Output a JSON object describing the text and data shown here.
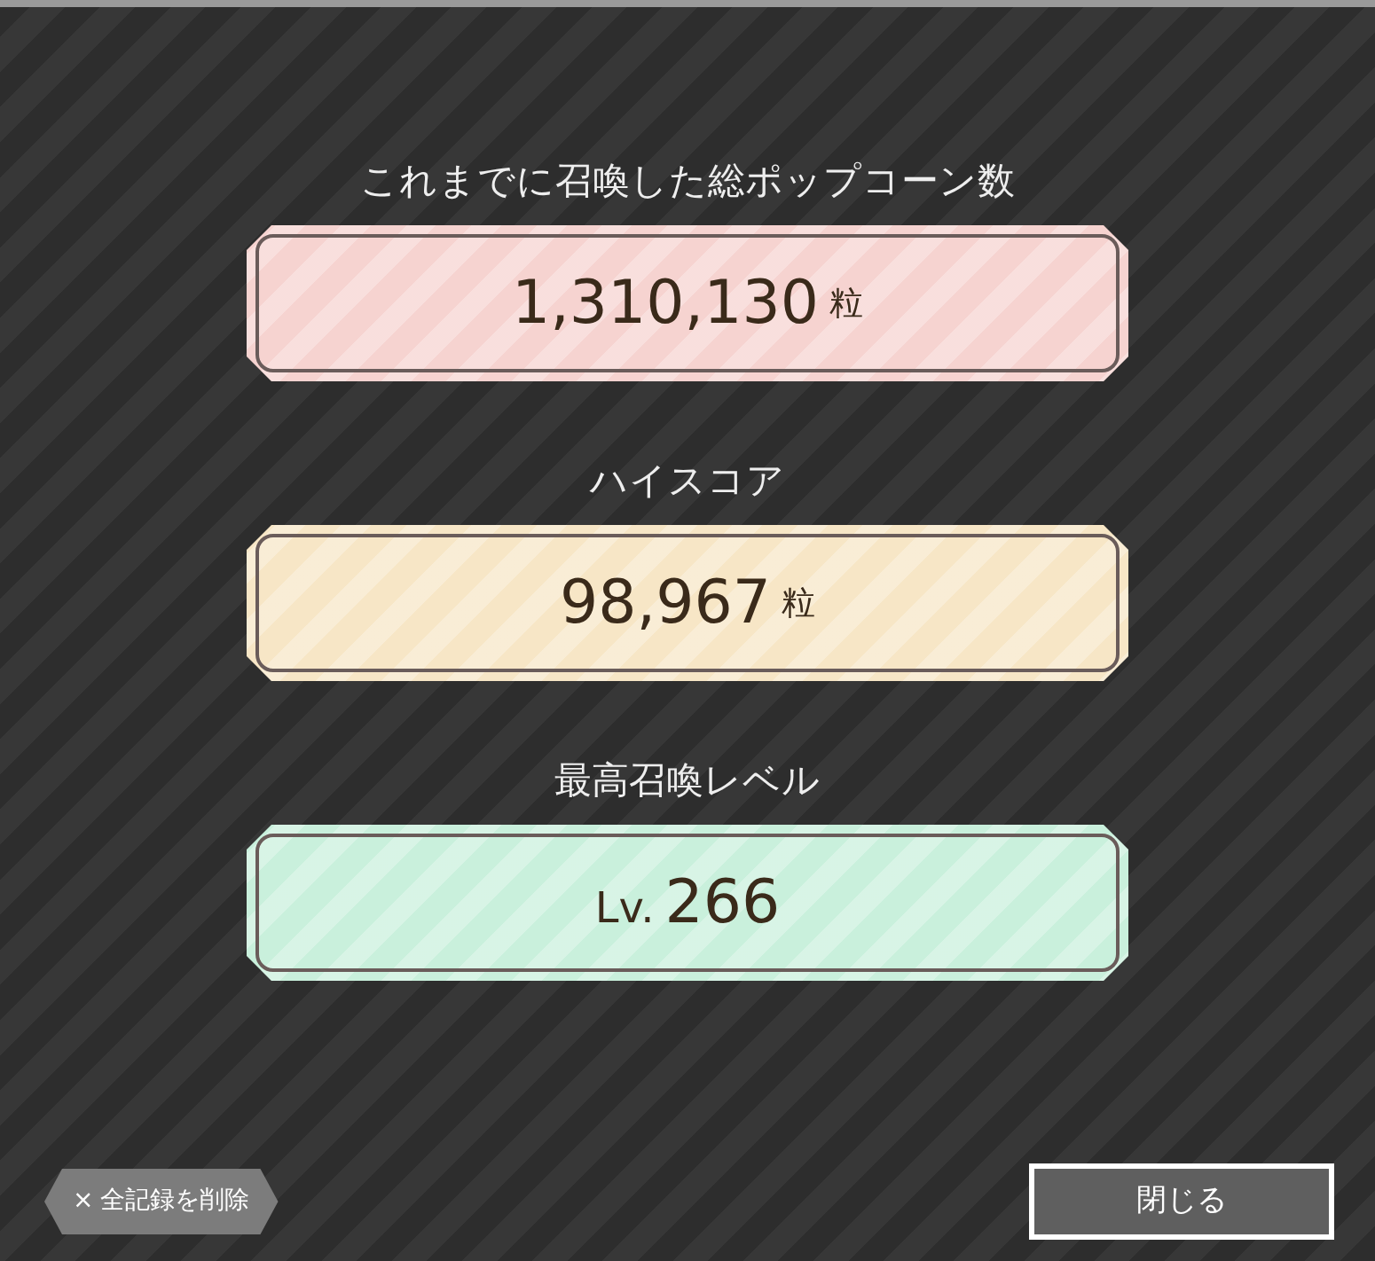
{
  "stats": [
    {
      "label": "これまでに召喚した総ポップコーン数",
      "value": "1,310,130",
      "unit": "粒",
      "color": "#f6d3d0"
    },
    {
      "label": "ハイスコア",
      "value": "98,967",
      "unit": "粒",
      "color": "#f7e6c6"
    },
    {
      "label": "最高召喚レベル",
      "prefix": "Lv.",
      "value": "266",
      "color": "#c9f0dc"
    }
  ],
  "delete_button": {
    "icon": "×",
    "label": "全記録を削除"
  },
  "close_button": {
    "label": "閉じる"
  }
}
